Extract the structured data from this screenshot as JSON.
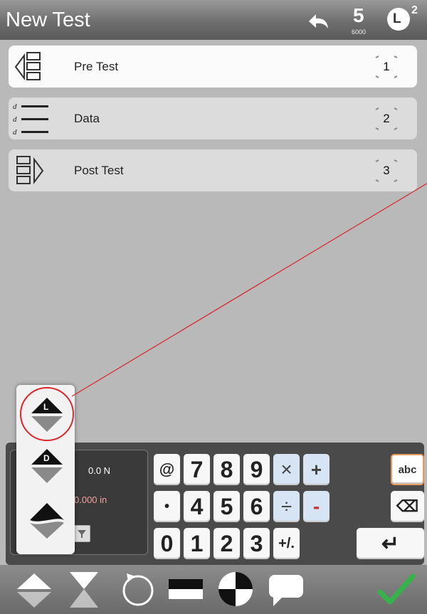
{
  "header": {
    "title": "New Test",
    "badge_digit": "5",
    "badge_sub": "6000",
    "level_letter": "L",
    "level_num": "2"
  },
  "steps": [
    {
      "label": "Pre Test",
      "number": "1",
      "icon": "pre-test-icon",
      "active": true
    },
    {
      "label": "Data",
      "number": "2",
      "icon": "data-icon",
      "active": false
    },
    {
      "label": "Post Test",
      "number": "3",
      "icon": "post-test-icon",
      "active": false
    }
  ],
  "readout": {
    "force": "0.0 N",
    "length": "0.000 in"
  },
  "keypad": {
    "row1": [
      "@",
      "7",
      "8",
      "9",
      "×",
      "+",
      "abc"
    ],
    "row2": [
      "•",
      "4",
      "5",
      "6",
      "÷",
      "-",
      "⌫"
    ],
    "row3": [
      "0",
      "1",
      "2",
      "3",
      "+/.",
      "↵"
    ]
  },
  "popup": {
    "items": [
      {
        "letter": "L",
        "icon": "limit-mode-icon"
      },
      {
        "letter": "D",
        "icon": "distance-mode-icon"
      },
      {
        "letter": "",
        "icon": "break-mode-icon"
      }
    ]
  },
  "colors": {
    "accent_red": "#d9262b",
    "confirm_green": "#35b34a",
    "abc_border": "#e89b5b"
  },
  "bottom_bar": [
    "up-down-arrows-icon",
    "hourglass-icon",
    "rotate-icon",
    "bar-icon",
    "quadrant-icon",
    "comment-icon",
    "confirm-check-icon"
  ]
}
